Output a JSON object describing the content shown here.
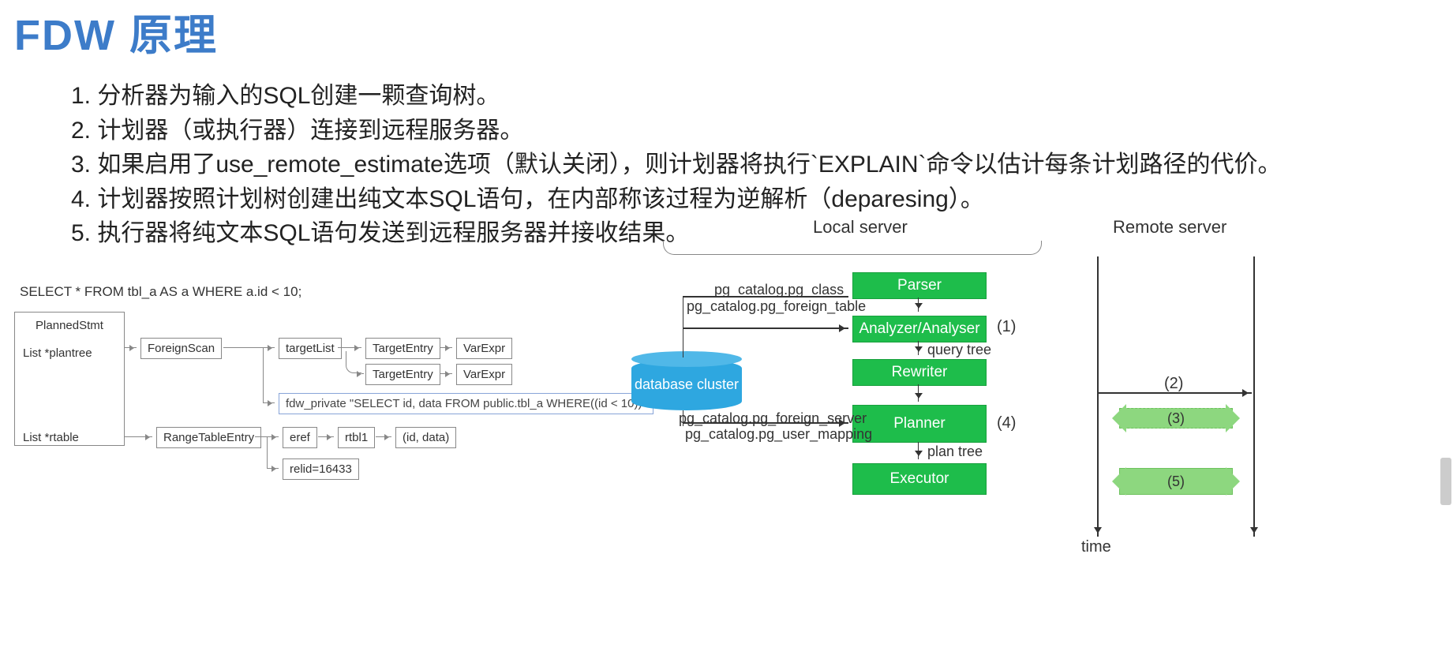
{
  "title": "FDW 原理",
  "steps": [
    "1. 分析器为输入的SQL创建一颗查询树。",
    "2. 计划器（或执行器）连接到远程服务器。",
    "3. 如果启用了use_remote_estimate选项（默认关闭），则计划器将执行`EXPLAIN`命令以估计每条计划路径的代价。",
    "4. 计划器按照计划树创建出纯文本SQL语句，在内部称该过程为逆解析（deparesing）。",
    "5. 执行器将纯文本SQL语句发送到远程服务器并接收结果。"
  ],
  "sql": "SELECT * FROM tbl_a AS a WHERE a.id < 10;",
  "tree": {
    "root": "PlannedStmt",
    "row1_label": "List   *plantree",
    "row2_label": "List   *rtable",
    "foreignscan": "ForeignScan",
    "targetlist": "targetList",
    "targetentry": "TargetEntry",
    "varexpr": "VarExpr",
    "fdw_private": "fdw_private \"SELECT id, data FROM public.tbl_a WHERE((id < 10))\"",
    "rangetableentry": "RangeTableEntry",
    "eref": "eref",
    "rtbl1": "rtbl1",
    "iddata": "(id, data)",
    "relid": "relid=16433"
  },
  "arch": {
    "local_label": "Local server",
    "remote_label": "Remote server",
    "parser": "Parser",
    "analyser": "Analyzer/Analyser",
    "rewriter": "Rewriter",
    "planner": "Planner",
    "executor": "Executor",
    "db": "database cluster",
    "cat1a": "pg_catalog.pg_class",
    "cat1b": "pg_catalog.pg_foreign_table",
    "cat2a": "pg_catalog.pg_foreign_server",
    "cat2b": "pg_catalog.pg_user_mapping",
    "qtree": "query tree",
    "ptree": "plan tree",
    "n1": "(1)",
    "n2": "(2)",
    "n3": "(3)",
    "n4": "(4)",
    "n5": "(5)",
    "time": "time"
  }
}
